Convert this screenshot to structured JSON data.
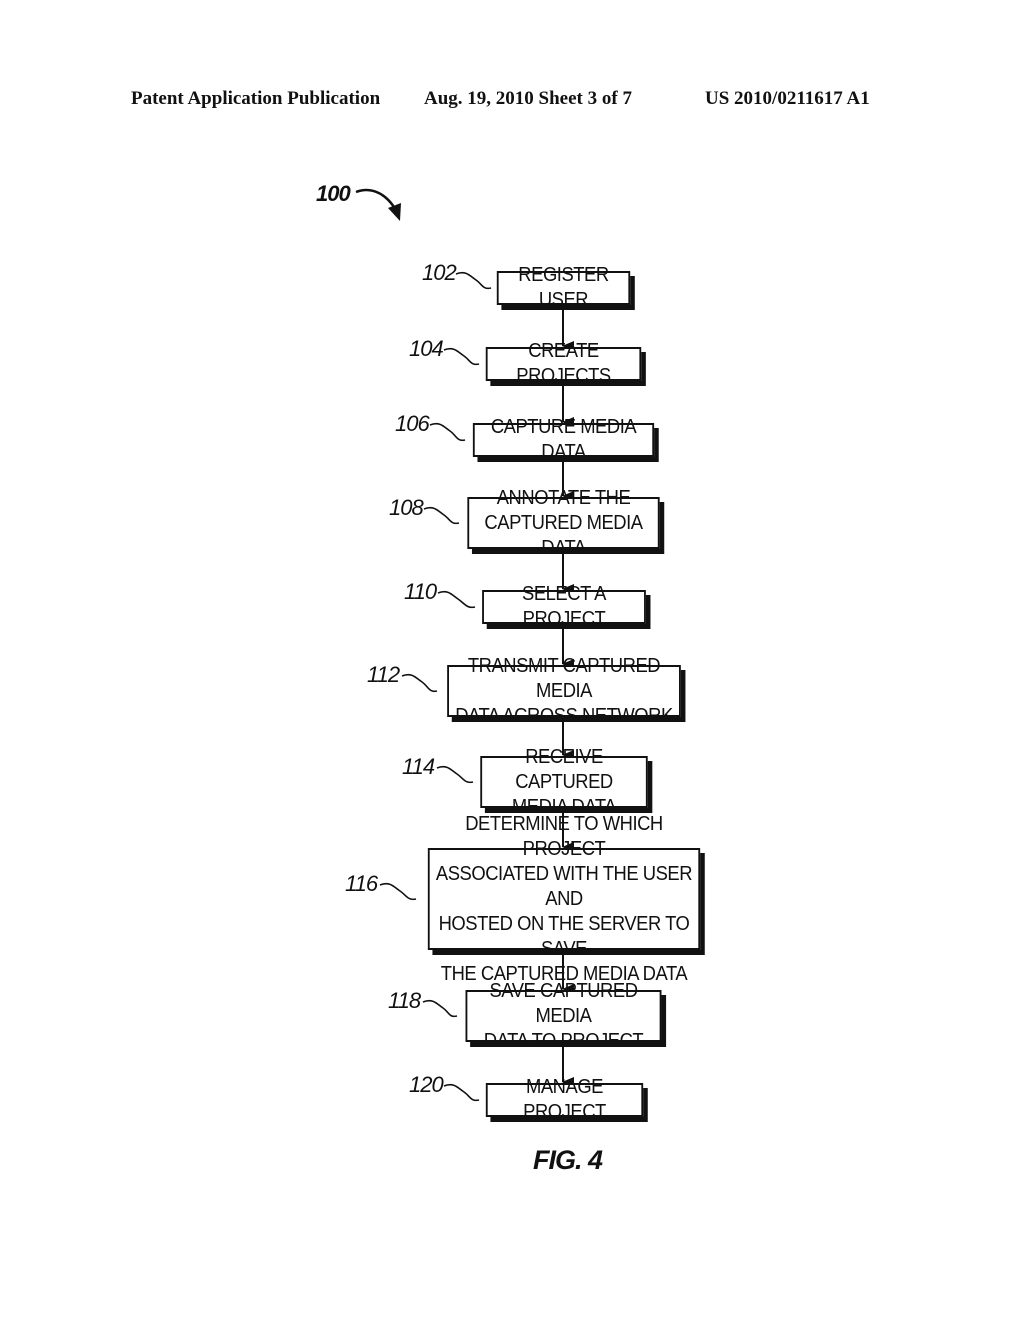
{
  "header": {
    "left": "Patent Application Publication",
    "middle": "Aug. 19, 2010  Sheet 3 of 7",
    "right": "US 2010/0211617 A1"
  },
  "figure": {
    "ref": "100",
    "caption": "FIG. 4"
  },
  "steps": [
    {
      "ref": "102",
      "text": "REGISTER USER"
    },
    {
      "ref": "104",
      "text": "CREATE PROJECTS"
    },
    {
      "ref": "106",
      "text": "CAPTURE MEDIA DATA"
    },
    {
      "ref": "108",
      "text": "ANNOTATE THE\nCAPTURED MEDIA DATA"
    },
    {
      "ref": "110",
      "text": "SELECT A PROJECT"
    },
    {
      "ref": "112",
      "text": "TRANSMIT CAPTURED MEDIA\nDATA ACROSS NETWORK"
    },
    {
      "ref": "114",
      "text": "RECEIVE CAPTURED\nMEDIA DATA"
    },
    {
      "ref": "116",
      "text": "DETERMINE TO WHICH PROJECT\nASSOCIATED WITH THE USER AND\nHOSTED ON THE SERVER TO SAVE\nTHE CAPTURED MEDIA DATA"
    },
    {
      "ref": "118",
      "text": "SAVE CAPTURED MEDIA\nDATA TO PROJECT"
    },
    {
      "ref": "120",
      "text": "MANAGE PROJECT"
    }
  ]
}
